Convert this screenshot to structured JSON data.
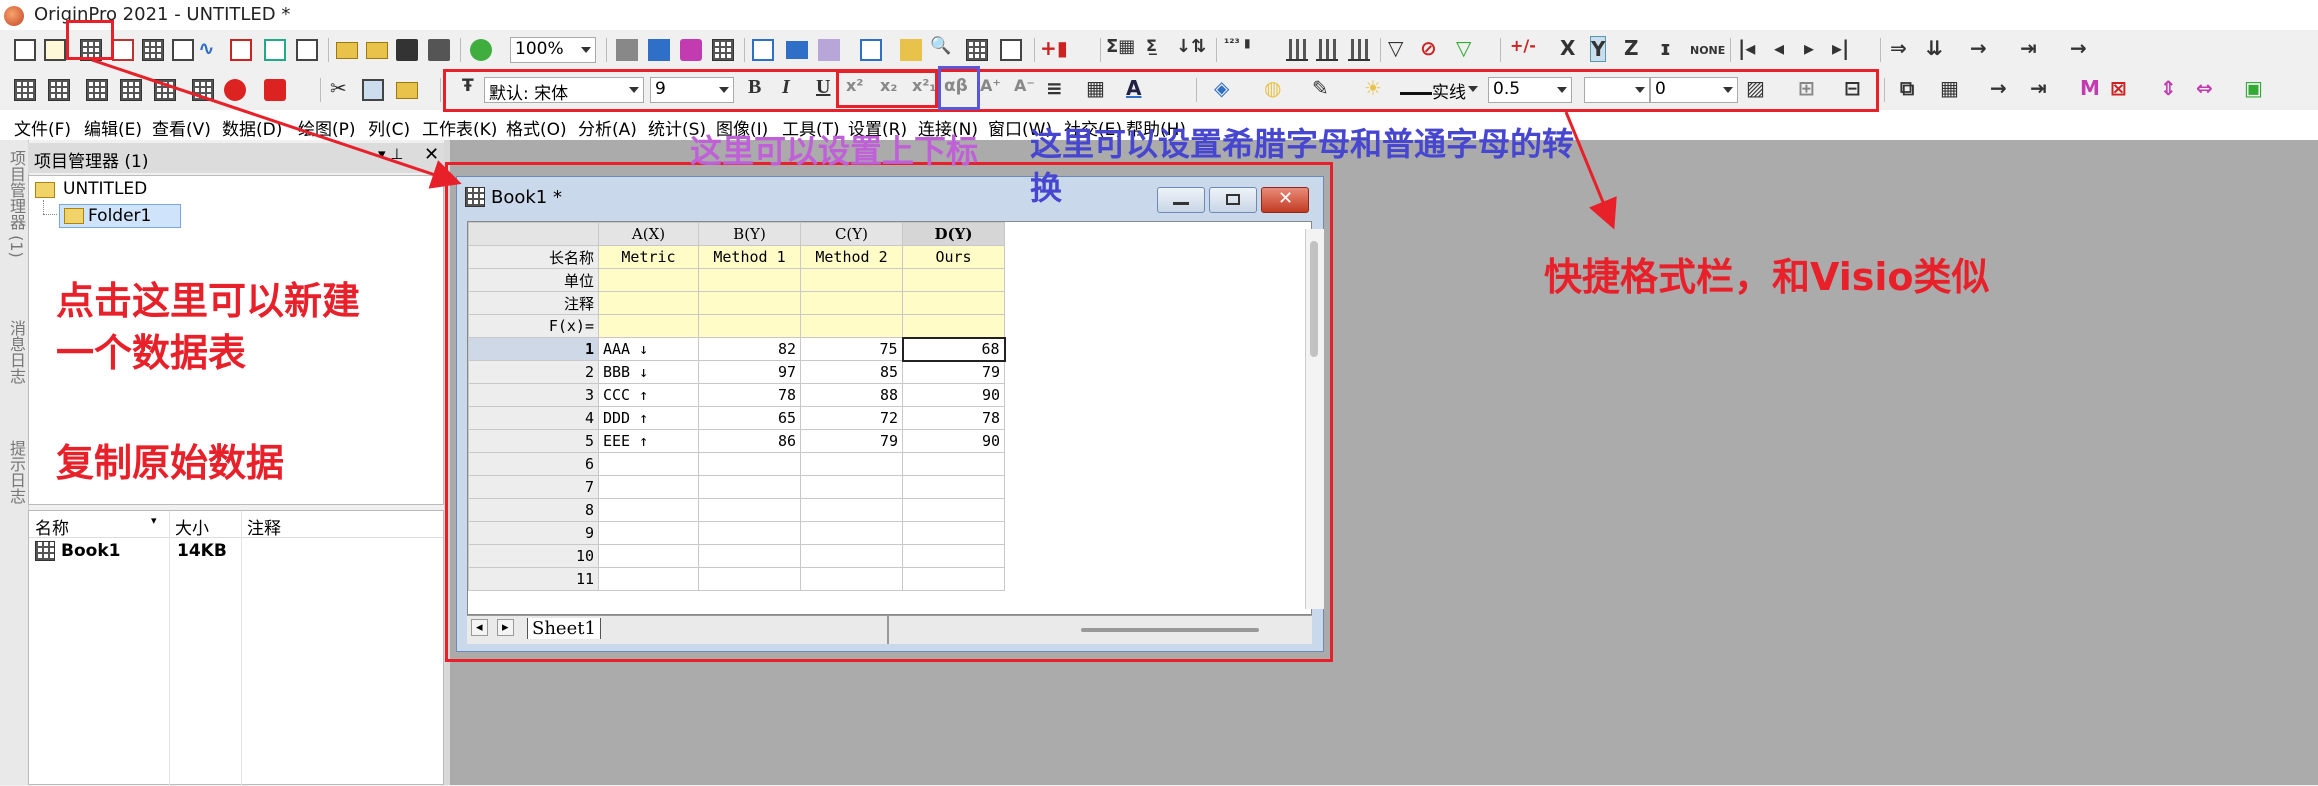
{
  "window": {
    "title": "OriginPro 2021 - UNTITLED *"
  },
  "toolbar1": {
    "zoom": "100%",
    "none_label": "NONE"
  },
  "toolbar2": {
    "font_name": "默认: 宋体",
    "font_size": "9",
    "line_style": "实线",
    "line_width": "0.5",
    "value2": "0"
  },
  "menu": [
    "文件(F)",
    "编辑(E)",
    "查看(V)",
    "数据(D)",
    "绘图(P)",
    "列(C)",
    "工作表(K)",
    "格式(O)",
    "分析(A)",
    "统计(S)",
    "图像(I)",
    "工具(T)",
    "设置(R)",
    "连接(N)",
    "窗口(W)",
    "社交(E)",
    "帮助(H)"
  ],
  "side_tabs": [
    "项目管理器 (1)",
    "消息日志",
    "提示日志"
  ],
  "project_manager": {
    "title": "项目管理器 (1)",
    "root": "UNTITLED",
    "folder": "Folder1",
    "columns": [
      "名称",
      "大小",
      "注释"
    ],
    "items": [
      {
        "name": "Book1",
        "size": "14KB",
        "note": ""
      }
    ]
  },
  "book": {
    "title": "Book1 *",
    "sheet_tab": "Sheet1",
    "columns": [
      "A(X)",
      "B(Y)",
      "C(Y)",
      "D(Y)"
    ],
    "meta_rows": [
      "长名称",
      "单位",
      "注释",
      "F(x)="
    ],
    "long_names": [
      "Metric",
      "Method 1",
      "Method 2",
      "Ours"
    ],
    "rows": [
      [
        "AAA ↓",
        "82",
        "75",
        "68"
      ],
      [
        "BBB ↓",
        "97",
        "85",
        "79"
      ],
      [
        "CCC ↑",
        "78",
        "88",
        "90"
      ],
      [
        "DDD ↑",
        "65",
        "72",
        "78"
      ],
      [
        "EEE ↑",
        "86",
        "79",
        "90"
      ]
    ],
    "row_numbers": [
      "1",
      "2",
      "3",
      "4",
      "5",
      "6",
      "7",
      "8",
      "9",
      "10",
      "11"
    ]
  },
  "annotations": {
    "new_sheet": "点击这里可以新建一个数据表",
    "copy_data": "复制原始数据",
    "superscript": "这里可以设置上下标",
    "greek": "这里可以设置希腊字母和普通字母的转换",
    "format_bar": "快捷格式栏，和Visio类似"
  },
  "colors": {
    "annotation_red": "#e8202a",
    "annotation_purple": "#c060d8",
    "annotation_blue": "#4646d0"
  }
}
